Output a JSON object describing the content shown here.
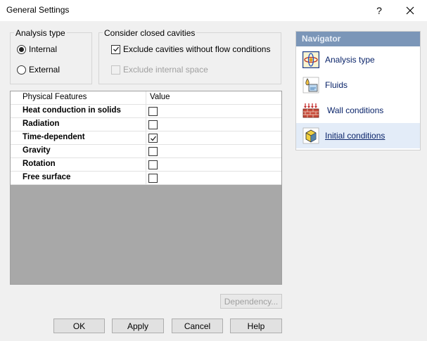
{
  "window": {
    "title": "General Settings",
    "help_glyph": "?",
    "close_glyph": "✕"
  },
  "analysis_type": {
    "label": "Analysis type",
    "options": [
      {
        "label": "Internal",
        "selected": true
      },
      {
        "label": "External",
        "selected": false
      }
    ]
  },
  "cavities": {
    "label": "Consider closed cavities",
    "exclude_no_flow": {
      "label": "Exclude cavities without flow conditions",
      "checked": true
    },
    "exclude_internal": {
      "label": "Exclude internal space",
      "checked": false,
      "disabled": true
    }
  },
  "features": {
    "headers": {
      "name": "Physical Features",
      "value": "Value"
    },
    "rows": [
      {
        "name": "Heat conduction in solids",
        "checked": false
      },
      {
        "name": "Radiation",
        "checked": false
      },
      {
        "name": "Time-dependent",
        "checked": true
      },
      {
        "name": "Gravity",
        "checked": false
      },
      {
        "name": "Rotation",
        "checked": false
      },
      {
        "name": "Free surface",
        "checked": false
      }
    ]
  },
  "buttons": {
    "dependency": "Dependency...",
    "ok": "OK",
    "apply": "Apply",
    "cancel": "Cancel",
    "help": "Help"
  },
  "navigator": {
    "title": "Navigator",
    "items": [
      {
        "label": "Analysis type",
        "icon": "analysis-type-icon"
      },
      {
        "label": "Fluids",
        "icon": "fluids-icon"
      },
      {
        "label": "Wall conditions",
        "icon": "wall-conditions-icon"
      },
      {
        "label": "Initial conditions",
        "icon": "initial-conditions-icon",
        "selected": true
      }
    ]
  },
  "colors": {
    "navigator_header": "#7b96b8",
    "nav_link": "#0a246a",
    "selection": "#e3ecf8"
  }
}
